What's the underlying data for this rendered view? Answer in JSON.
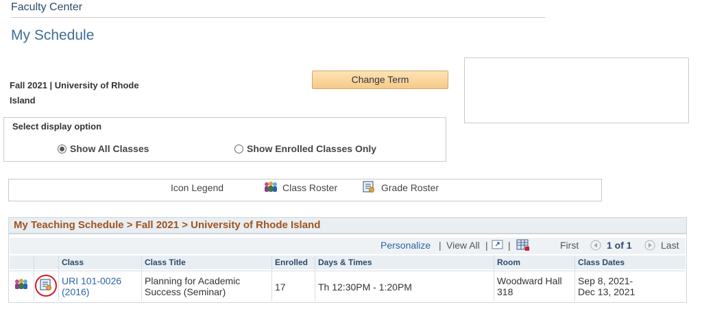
{
  "header": {
    "breadcrumb": "Faculty Center",
    "title": "My Schedule"
  },
  "term": {
    "label_line1": "Fall 2021 | University of Rhode",
    "label_line2": "Island",
    "change_button": "Change Term"
  },
  "display_options": {
    "title": "Select display option",
    "options": [
      {
        "label": "Show All Classes",
        "selected": true
      },
      {
        "label": "Show Enrolled Classes Only",
        "selected": false
      }
    ]
  },
  "legend": {
    "label": "Icon Legend",
    "items": [
      {
        "icon": "class-roster-icon",
        "label": "Class Roster"
      },
      {
        "icon": "grade-roster-icon",
        "label": "Grade Roster"
      }
    ]
  },
  "schedule": {
    "title": "My Teaching Schedule > Fall 2021 > University of Rhode Island",
    "personalize": "Personalize",
    "view_all": "View All",
    "separator": "|",
    "first": "First",
    "page_info": "1 of 1",
    "last": "Last",
    "columns": [
      "Class",
      "Class Title",
      "Enrolled",
      "Days & Times",
      "Room",
      "Class Dates"
    ],
    "rows": [
      {
        "class_line1": "URI 101-0026",
        "class_line2": "(2016)",
        "title_line1": "Planning for Academic",
        "title_line2": "Success (Seminar)",
        "enrolled": "17",
        "days_times": "Th 12:30PM - 1:20PM",
        "room_line1": "Woodward Hall",
        "room_line2": "318",
        "dates_line1": "Sep 8, 2021-",
        "dates_line2": "Dec 13, 2021"
      }
    ]
  },
  "colors": {
    "accent_blue": "#2a64a8",
    "title_orange": "#a0521d",
    "highlight_red": "#d0192a",
    "button_orange": "#f6c98a"
  }
}
